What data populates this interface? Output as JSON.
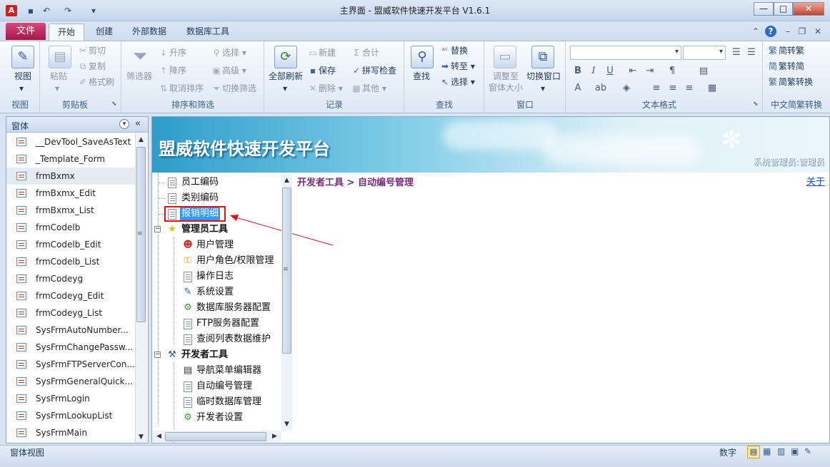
{
  "window": {
    "title": "主界面 - 盟威软件快速开发平台 V1.6.1",
    "app_icon_letter": "A",
    "controls": {
      "minimize": "—",
      "maximize": "□",
      "close": "✕"
    }
  },
  "ribbon_tabs": {
    "file": "文件",
    "tabs": [
      "开始",
      "创建",
      "外部数据",
      "数据库工具"
    ]
  },
  "ribbon": {
    "views": {
      "group": "视图",
      "view": "视图"
    },
    "clipboard": {
      "group": "剪贴板",
      "paste": "粘贴",
      "cut": "剪切",
      "copy": "复制",
      "format_painter": "格式刷"
    },
    "sort_filter": {
      "group": "排序和筛选",
      "filter": "筛选器",
      "ascending": "升序",
      "descending": "降序",
      "clear_sort": "取消排序",
      "selection": "选择",
      "advanced": "高级",
      "toggle_filter": "切换筛选"
    },
    "records": {
      "group": "记录",
      "refresh_all": "全部刷新",
      "new": "新建",
      "save": "保存",
      "delete": "删除",
      "totals": "合计",
      "spelling": "拼写检查",
      "more": "其他"
    },
    "find": {
      "group": "查找",
      "find": "查找",
      "replace": "替换",
      "goto": "转至",
      "select": "选择"
    },
    "window": {
      "group": "窗口",
      "size_to_fit": "调整至\n窗体大小",
      "switch_windows": "切换窗口"
    },
    "text_format": {
      "group": "文本格式"
    },
    "chinese_convert": {
      "group": "中文简繁转换",
      "to_traditional": "简转繁",
      "to_simplified": "繁转简",
      "convert": "简繁转换"
    }
  },
  "nav_pane": {
    "title": "窗体",
    "items": [
      "__DevTool_SaveAsText",
      "_Template_Form",
      "frmBxmx",
      "frmBxmx_Edit",
      "frmBxmx_List",
      "frmCodelb",
      "frmCodelb_Edit",
      "frmCodelb_List",
      "frmCodeyg",
      "frmCodeyg_Edit",
      "frmCodeyg_List",
      "SysFrmAutoNumber...",
      "SysFrmChangePassw...",
      "SysFrmFTPServerCon...",
      "SysFrmGeneralQuick...",
      "SysFrmLogin",
      "SysFrmLookupList",
      "SysFrmMain"
    ],
    "selected_index": 2
  },
  "banner": {
    "title": "盟威软件快速开发平台",
    "user": "系统管理员:管理员"
  },
  "tree": {
    "top_items": [
      "员工编码",
      "类别编码",
      "报销明细"
    ],
    "admin_group": "管理员工具",
    "admin_items": [
      "用户管理",
      "用户角色/权限管理",
      "操作日志",
      "系统设置",
      "数据库服务器配置",
      "FTP服务器配置",
      "查阅列表数据维护"
    ],
    "dev_group": "开发者工具",
    "dev_items": [
      "导航菜单编辑器",
      "自动编号管理",
      "临时数据库管理",
      "开发者设置"
    ]
  },
  "content": {
    "breadcrumb": "开发者工具 > 自动编号管理",
    "about": "关于"
  },
  "status": {
    "left": "窗体视图",
    "num_lock": "数字"
  }
}
